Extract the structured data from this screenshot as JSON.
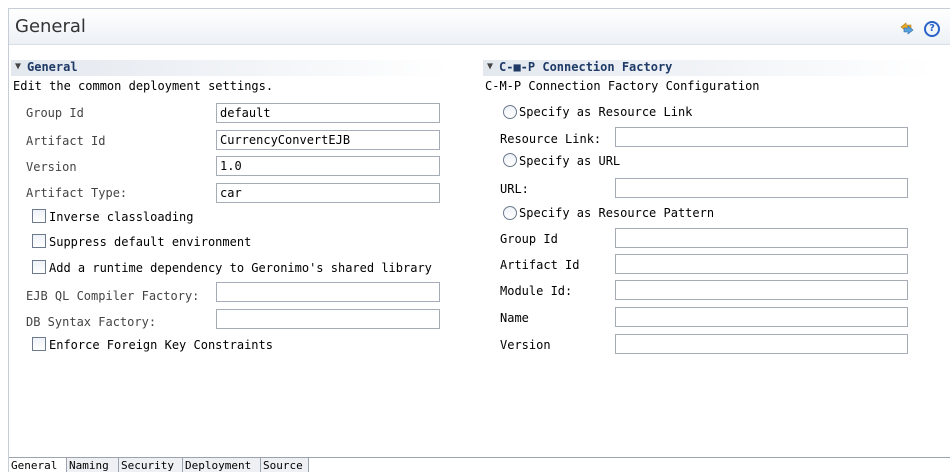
{
  "header": {
    "title": "General",
    "sync_icon": "sync-icon",
    "help_icon": "help-icon",
    "help_glyph": "?"
  },
  "general": {
    "section_title": "General",
    "description": "Edit the common deployment settings.",
    "group_id": {
      "label": "Group Id",
      "value": "default"
    },
    "artifact_id": {
      "label": "Artifact Id",
      "value": "CurrencyConvertEJB"
    },
    "version": {
      "label": "Version",
      "value": "1.0"
    },
    "artifact_type": {
      "label": "Artifact Type:",
      "value": "car"
    },
    "inverse_classloading": {
      "label": "Inverse classloading",
      "checked": false
    },
    "suppress_default_env": {
      "label": "Suppress default environment",
      "checked": false
    },
    "runtime_dependency": {
      "label": "Add a runtime dependency to Geronimo's shared library",
      "checked": false
    },
    "ejb_ql_compiler_factory": {
      "label": "EJB QL Compiler Factory:",
      "value": ""
    },
    "db_syntax_factory": {
      "label": "DB Syntax Factory:",
      "value": ""
    },
    "enforce_foreign_key": {
      "label": "Enforce Foreign Key Constraints",
      "checked": false
    }
  },
  "cmp": {
    "section_title": "C-■-P Connection Factory",
    "description": "C-M-P Connection Factory Configuration",
    "radio_resource_link": {
      "label": "Specify as Resource Link",
      "selected": false
    },
    "resource_link": {
      "label": "Resource Link:",
      "value": ""
    },
    "radio_url": {
      "label": "Specify as URL",
      "selected": false
    },
    "url": {
      "label": "URL:",
      "value": ""
    },
    "radio_resource_pattern": {
      "label": "Specify as Resource Pattern",
      "selected": false
    },
    "group_id": {
      "label": "Group Id",
      "value": ""
    },
    "artifact_id": {
      "label": "Artifact Id",
      "value": ""
    },
    "module_id": {
      "label": "Module Id:",
      "value": ""
    },
    "name": {
      "label": "Name",
      "value": ""
    },
    "version": {
      "label": "Version",
      "value": ""
    }
  },
  "tabs": [
    {
      "label": "General",
      "active": true
    },
    {
      "label": "Naming",
      "active": false
    },
    {
      "label": "Security",
      "active": false
    },
    {
      "label": "Deployment",
      "active": false
    },
    {
      "label": "Source",
      "active": false
    }
  ],
  "colors": {
    "section_title": "#1f3a66",
    "help_icon": "#2a62c9"
  }
}
